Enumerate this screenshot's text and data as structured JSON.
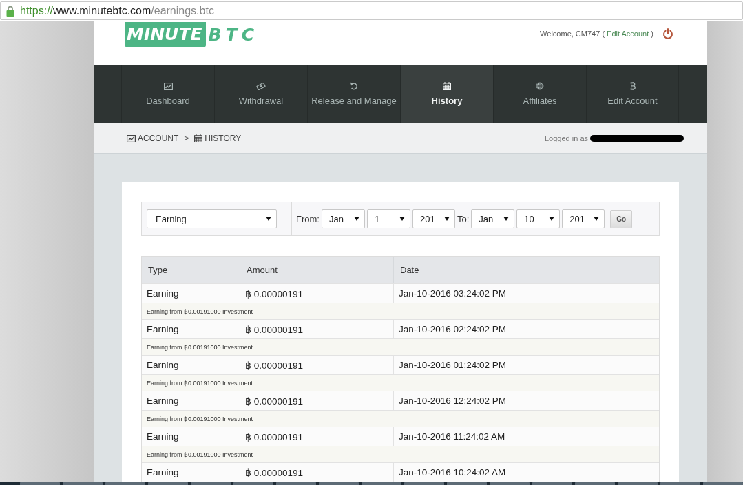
{
  "browser": {
    "address_bar": {
      "secure": true,
      "scheme": "https://",
      "host": "www.minutebtc.com",
      "path": "/earnings.btc"
    }
  },
  "header": {
    "logo": {
      "word_1": "MINUTE",
      "word_2": "BTC"
    },
    "welcome": {
      "before": "Welcome, CM747 (",
      "link": "Edit Account",
      "after": ")"
    }
  },
  "nav": {
    "items": [
      {
        "label": "Dashboard",
        "selected": false
      },
      {
        "label": "Withdrawal",
        "selected": false
      },
      {
        "label": "Release and Manage",
        "selected": false
      },
      {
        "label": "History",
        "selected": true
      },
      {
        "label": "Affiliates",
        "selected": false
      },
      {
        "label": "Edit Account",
        "selected": false
      }
    ]
  },
  "breadcrumb_bar": {
    "crumbs": [
      {
        "label": "ACCOUNT"
      },
      {
        "label": "HISTORY"
      }
    ],
    "separator": ">",
    "logged_in": {
      "label": "Logged in as",
      "redacted": true
    }
  },
  "filter": {
    "type": "Earning",
    "from_label": "From:",
    "from": {
      "month": "Jan",
      "day": "1",
      "year": "201"
    },
    "to_label": "To:",
    "to": {
      "month": "Jan",
      "day": "10",
      "year": "201"
    },
    "go": "Go"
  },
  "table": {
    "columns": [
      "Type",
      "Amount",
      "Date"
    ],
    "rows": [
      {
        "type": "Earning",
        "amount": "฿ 0.00000191",
        "date": "Jan-10-2016 03:24:02 PM",
        "note": "Earning from ฿0.00191000 Investment"
      },
      {
        "type": "Earning",
        "amount": "฿ 0.00000191",
        "date": "Jan-10-2016 02:24:02 PM",
        "note": "Earning from ฿0.00191000 Investment"
      },
      {
        "type": "Earning",
        "amount": "฿ 0.00000191",
        "date": "Jan-10-2016 01:24:02 PM",
        "note": "Earning from ฿0.00191000 Investment"
      },
      {
        "type": "Earning",
        "amount": "฿ 0.00000191",
        "date": "Jan-10-2016 12:24:02 PM",
        "note": "Earning from ฿0.00191000 Investment"
      },
      {
        "type": "Earning",
        "amount": "฿ 0.00000191",
        "date": "Jan-10-2016 11:24:02 AM",
        "note": "Earning from ฿0.00191000 Investment"
      },
      {
        "type": "Earning",
        "amount": "฿ 0.00000191",
        "date": "Jan-10-2016 10:24:02 AM"
      }
    ]
  }
}
